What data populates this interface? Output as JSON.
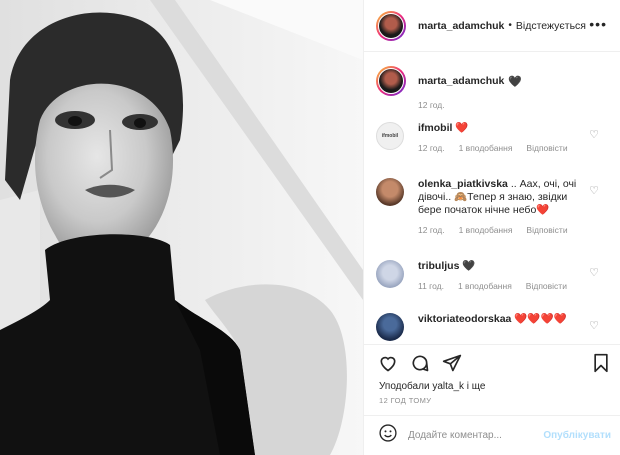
{
  "post_author": {
    "username": "marta_adamchuk",
    "separator": "•",
    "follow_label": "Відстежується",
    "more_label": "•••"
  },
  "caption": {
    "username": "marta_adamchuk",
    "text": "🖤",
    "time": "12 год."
  },
  "comments": [
    {
      "username": "ifmobil",
      "text": "❤️",
      "time": "12 год.",
      "likes": "1 вподобання",
      "reply": "Відповісти"
    },
    {
      "username": "olenka_piatkivska",
      "text": ".. Аах, очі, очі дівочі.. 🙈Тепер я знаю, звідки бере початок нічне небо❤️",
      "time": "12 год.",
      "likes": "1 вподобання",
      "reply": "Відповісти"
    },
    {
      "username": "tribuljus",
      "text": "🖤",
      "time": "11 год.",
      "likes": "1 вподобання",
      "reply": "Відповісти"
    },
    {
      "username": "viktoriateodorskaa",
      "text": "❤️❤️❤️❤️"
    }
  ],
  "ifmobil_avatar_text": "ifmobil",
  "likes_line": "Уподобали yalta_k і ще",
  "posted_ago": "12 ГОД ТОМУ",
  "add_comment": {
    "placeholder": "Додайте коментар...",
    "publish_label": "Опублікувати"
  },
  "colors": {
    "accent_disabled": "#b2dffc",
    "heart_red": "#ed4956",
    "muted": "#8e8e8e"
  }
}
